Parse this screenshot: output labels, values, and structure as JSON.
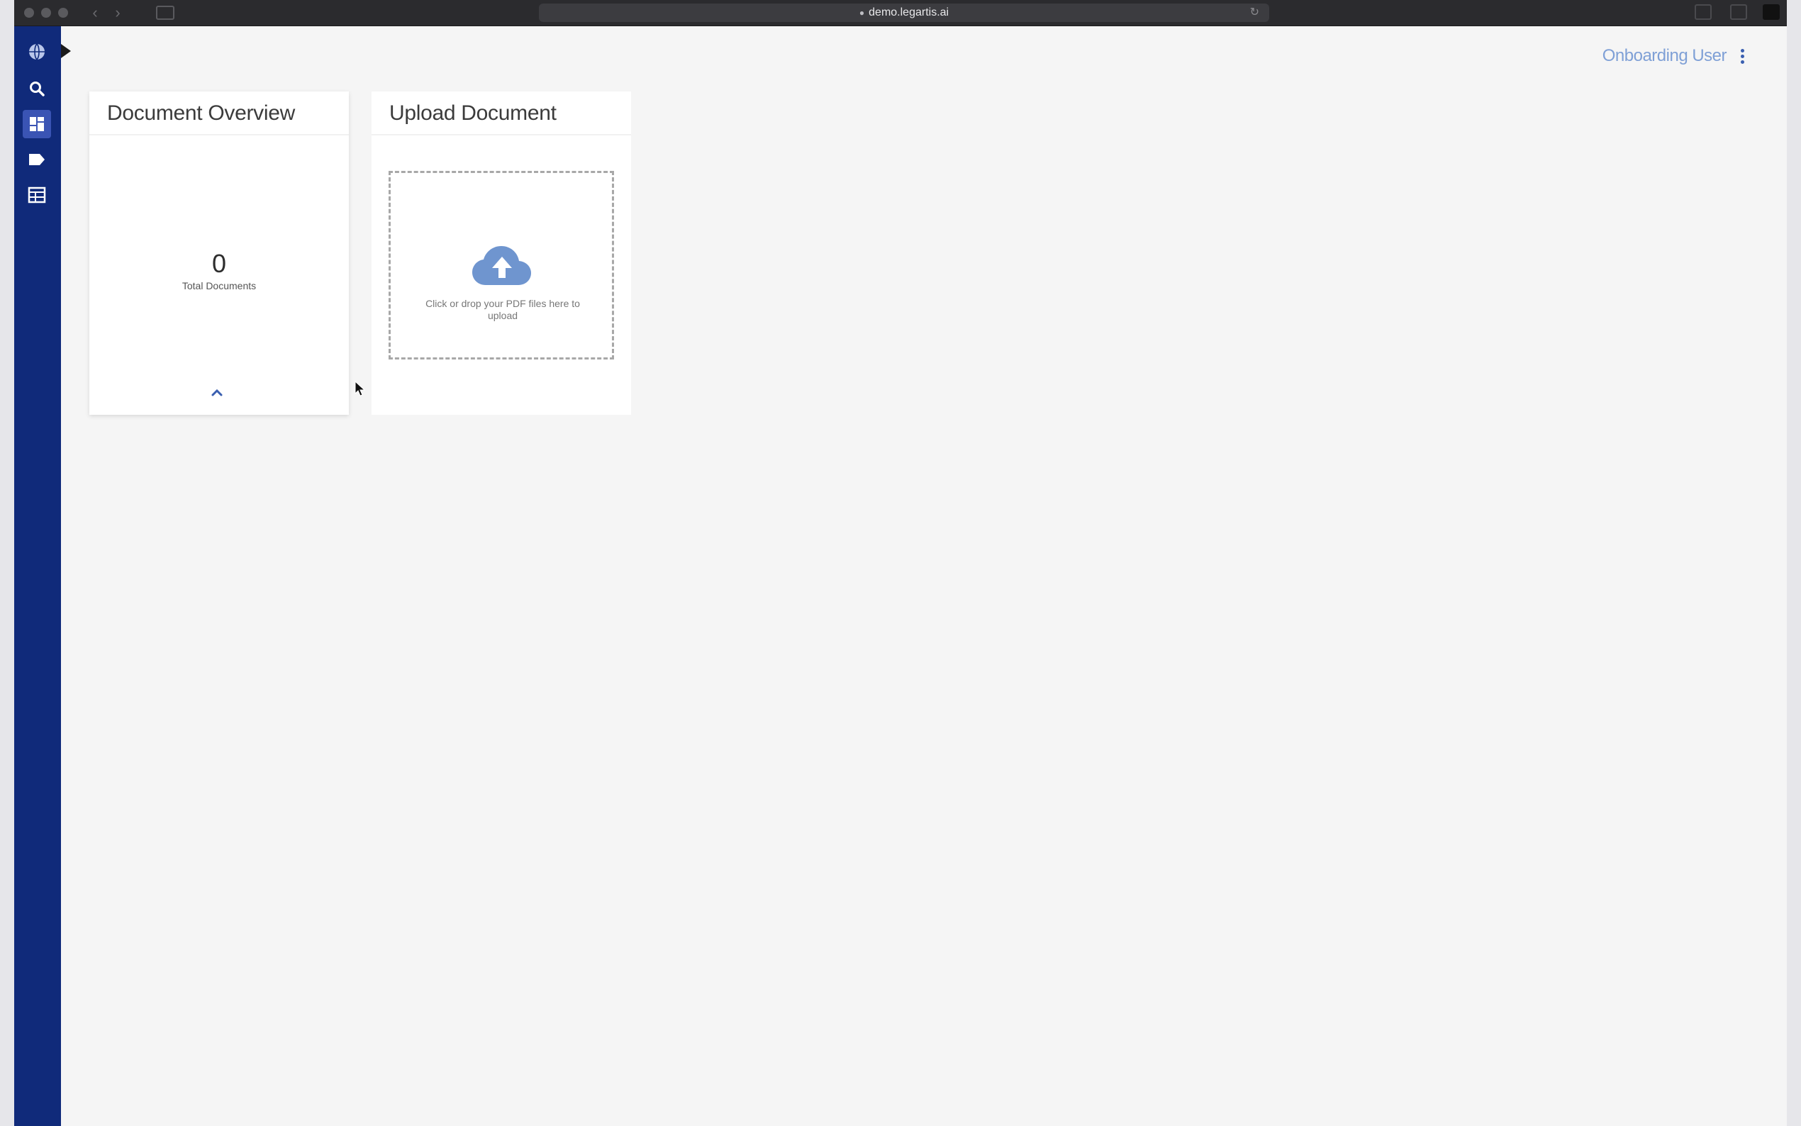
{
  "browser": {
    "url": "demo.legartis.ai"
  },
  "header": {
    "user_name": "Onboarding User"
  },
  "sidebar": {
    "items": [
      {
        "name": "logo",
        "icon": "globe-icon",
        "active": false
      },
      {
        "name": "search",
        "icon": "search-icon",
        "active": false
      },
      {
        "name": "dashboard",
        "icon": "dashboard-icon",
        "active": true
      },
      {
        "name": "labels",
        "icon": "tag-icon",
        "active": false
      },
      {
        "name": "documents",
        "icon": "table-icon",
        "active": false
      }
    ]
  },
  "overview_card": {
    "title": "Document Overview",
    "total_count": "0",
    "total_label": "Total Documents"
  },
  "upload_card": {
    "title": "Upload Document",
    "hint": "Click or drop your PDF files here to upload"
  },
  "colors": {
    "sidebar": "#102a7a",
    "active_item": "#3a54b4",
    "accent": "#7fa0d6",
    "cloud": "#6f95cf"
  }
}
